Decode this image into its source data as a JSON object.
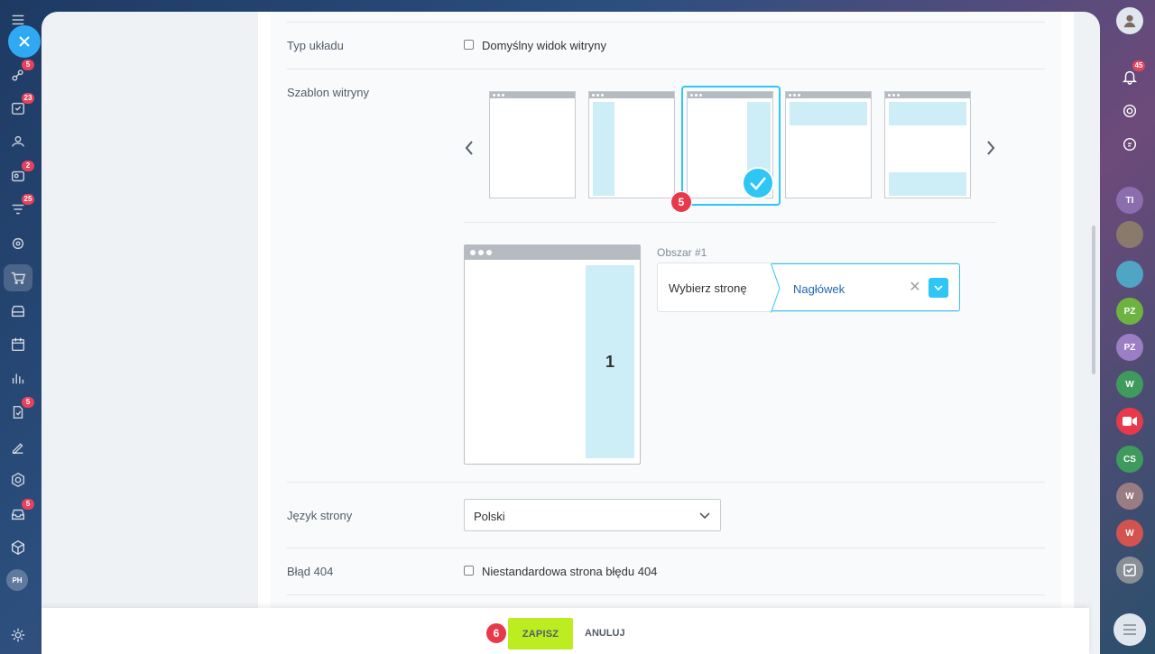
{
  "left_rail": {
    "badges": {
      "b1": "5",
      "b2": "23",
      "b3": "2",
      "b4": "25",
      "b5": "5",
      "b6": "5"
    },
    "avatar_initials": "PH"
  },
  "form": {
    "layout_type": {
      "label": "Typ układu",
      "checkbox_label": "Domyślny widok witryny"
    },
    "site_template": {
      "label": "Szablon witryny"
    },
    "area": {
      "title": "Obszar #1",
      "choose_page": "Wybierz stronę",
      "selected_value": "Nagłówek",
      "preview_number": "1"
    },
    "language": {
      "label": "Język strony",
      "value": "Polski"
    },
    "error404": {
      "label": "Błąd 404",
      "checkbox_label": "Niestandardowa strona błędu 404"
    }
  },
  "annotations": {
    "step5": "5",
    "step6": "6"
  },
  "footer": {
    "save_label": "ZAPISZ",
    "cancel_label": "ANULUJ"
  },
  "right_rail": {
    "notif_badge": "45",
    "avatars": [
      "TI",
      "PZ",
      "PZ",
      "W",
      "CS",
      "W",
      "W"
    ]
  },
  "colors": {
    "accent": "#2fc6f6",
    "save": "#bbed21",
    "badge": "#e8394a"
  }
}
